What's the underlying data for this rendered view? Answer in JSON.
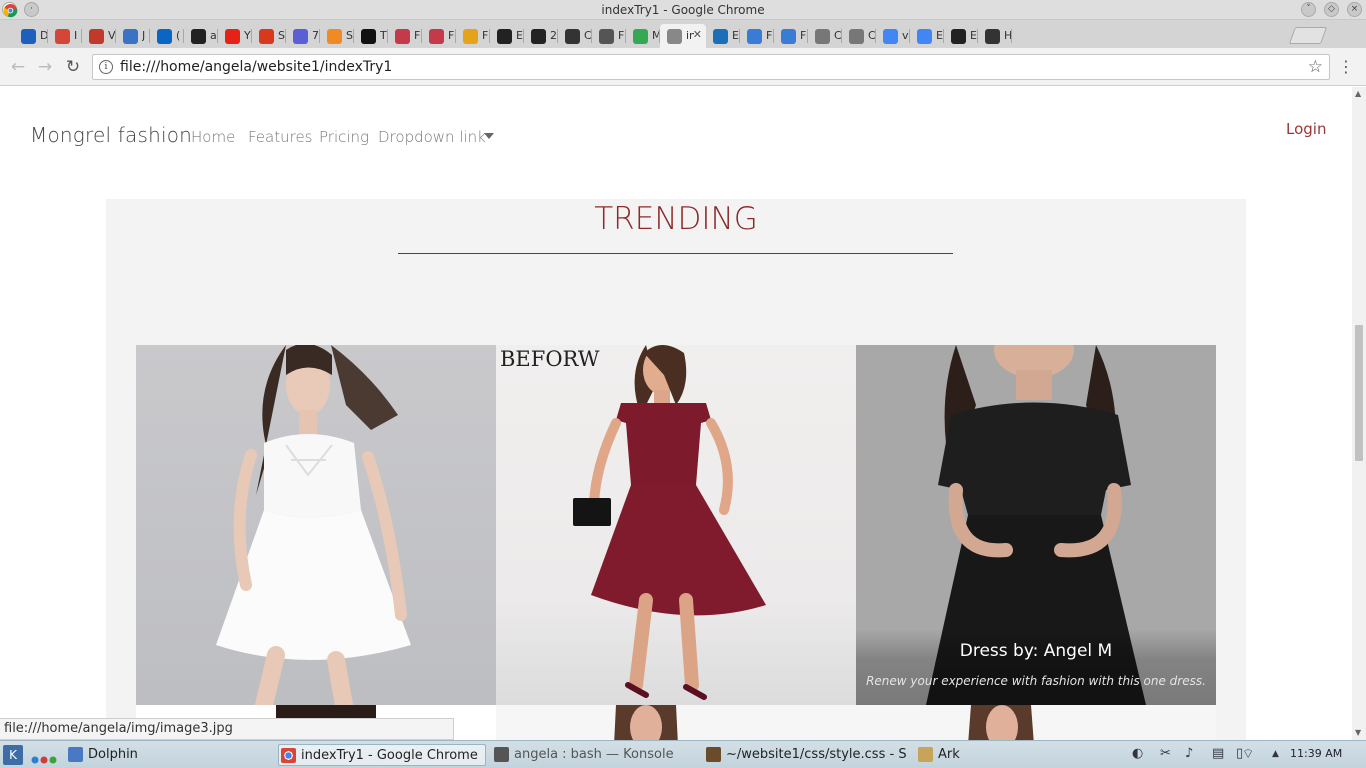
{
  "window": {
    "title": "indexTry1 - Google Chrome"
  },
  "tabs": [
    {
      "label": "D",
      "icon": "onedrive-icon",
      "color": "#1c5fbd"
    },
    {
      "label": "I",
      "icon": "gmail-icon",
      "color": "#d44638"
    },
    {
      "label": "V",
      "icon": "signature-icon",
      "color": "#c0392b"
    },
    {
      "label": "J",
      "icon": "info-icon",
      "color": "#3b73c4"
    },
    {
      "label": "(",
      "icon": "linkedin-icon",
      "color": "#0a66c2"
    },
    {
      "label": "a",
      "icon": "blackboard-icon",
      "color": "#222222"
    },
    {
      "label": "Y",
      "icon": "youtube-icon",
      "color": "#e62117"
    },
    {
      "label": "S",
      "icon": "m-red-icon",
      "color": "#d9381e"
    },
    {
      "label": "7",
      "icon": "pocket-icon",
      "color": "#5b5fd6"
    },
    {
      "label": "S",
      "icon": "asterisk-icon",
      "color": "#f08a24"
    },
    {
      "label": "T",
      "icon": "medium-icon",
      "color": "#111111"
    },
    {
      "label": "F",
      "icon": "link-red-icon",
      "color": "#c53a4a"
    },
    {
      "label": "F",
      "icon": "link-red-icon",
      "color": "#c53a4a"
    },
    {
      "label": "F",
      "icon": "pinwheel-icon",
      "color": "#e5a31a"
    },
    {
      "label": "E",
      "icon": "diamond-icon",
      "color": "#222222"
    },
    {
      "label": "2",
      "icon": "f-box-icon",
      "color": "#222222"
    },
    {
      "label": "C",
      "icon": "codepen-icon",
      "color": "#333333"
    },
    {
      "label": "F",
      "icon": "codepen-icon",
      "color": "#555555"
    },
    {
      "label": "M",
      "icon": "maps-icon",
      "color": "#34a853"
    },
    {
      "label": "in",
      "icon": "page-icon",
      "color": "#888888",
      "active": true
    },
    {
      "label": "E",
      "icon": "bootstrap-icon",
      "color": "#1b6fb9"
    },
    {
      "label": "F",
      "icon": "code-icon",
      "color": "#3a7bd5"
    },
    {
      "label": "F",
      "icon": "code-icon",
      "color": "#3a7bd5"
    },
    {
      "label": "C",
      "icon": "doc-icon",
      "color": "#777777"
    },
    {
      "label": "C",
      "icon": "doc-icon",
      "color": "#777777"
    },
    {
      "label": "v",
      "icon": "google-icon",
      "color": "#4285f4"
    },
    {
      "label": "E",
      "icon": "google-icon",
      "color": "#4285f4"
    },
    {
      "label": "E",
      "icon": "b-icon",
      "color": "#222222"
    },
    {
      "label": "H",
      "icon": "x-box-icon",
      "color": "#333333"
    }
  ],
  "toolbar": {
    "url": "file:///home/angela/website1/indexTry1",
    "back_icon": "arrow-left-icon",
    "forward_icon": "arrow-right-icon",
    "reload_icon": "reload-icon",
    "info_icon": "info-circle-icon",
    "bookmark_icon": "star-icon",
    "menu_icon": "kebab-menu-icon"
  },
  "site": {
    "brand": "Mongrel fashion",
    "nav": [
      "Home",
      "Features",
      "Pricing",
      "Dropdown link"
    ],
    "login": "Login",
    "trending_title": "TRENDING",
    "photo2_label": "BEFORW",
    "caption_title": "Dress by: Angel M",
    "caption_text": "Renew your experience with fashion with this one dress.",
    "accent": "#8c2a2a"
  },
  "status_url": "file:///home/angela/img/image3.jpg",
  "taskbar": {
    "items": [
      {
        "label": "Dolphin",
        "active": false
      },
      {
        "label": "indexTry1 - Google Chrome",
        "active": true
      },
      {
        "label": "angela : bash — Konsole",
        "active": false
      },
      {
        "label": "~/website1/css/style.css - S",
        "active": false
      },
      {
        "label": "Ark",
        "active": false
      }
    ],
    "clock": "11:39 AM"
  }
}
